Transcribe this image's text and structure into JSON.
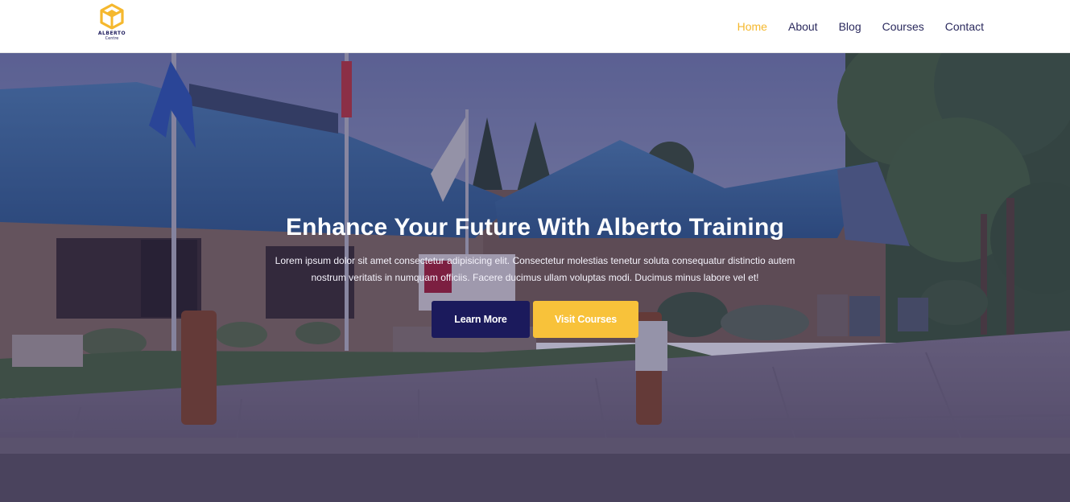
{
  "brand": {
    "name": "ALBERTO",
    "subtitle": "Centre"
  },
  "colors": {
    "accent": "#f5b82e",
    "primary": "#1b1a5c",
    "nav_text": "#2b2a5e"
  },
  "nav": {
    "items": [
      {
        "label": "Home",
        "active": true
      },
      {
        "label": "About",
        "active": false
      },
      {
        "label": "Blog",
        "active": false
      },
      {
        "label": "Courses",
        "active": false
      },
      {
        "label": "Contact",
        "active": false
      }
    ]
  },
  "hero": {
    "title": "Enhance Your Future With Alberto Training",
    "description": "Lorem ipsum dolor sit amet consectetur adipisicing elit. Consectetur molestias tenetur soluta consequatur distinctio autem nostrum veritatis in numquam officiis. Facere ducimus ullam voluptas modi. Ducimus minus labore vel et!",
    "primary_button": "Learn More",
    "secondary_button": "Visit Courses"
  }
}
